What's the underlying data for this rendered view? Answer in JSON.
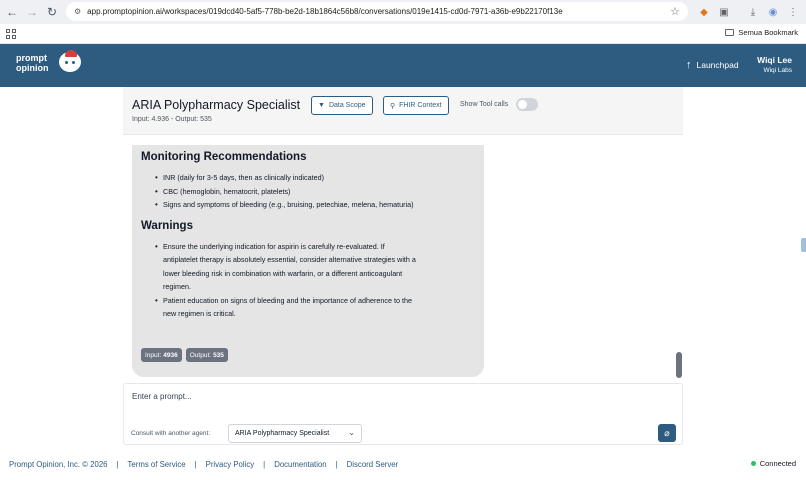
{
  "browser": {
    "url": "app.promptopinion.ai/workspaces/019dcd40-5af5-778b-be2d-18b1864c56b8/conversations/019e1415-cd0d-7971-a36b-e9b22170f13e",
    "bookmark_folder": "Semua Bookmark"
  },
  "header": {
    "logo_line1": "prompt",
    "logo_line2": "opinion",
    "launchpad_label": "Launchpad",
    "user_name": "Wiqi Lee",
    "user_org": "Wiqi Labs",
    "brand_color": "#2e5c80"
  },
  "conversation": {
    "title": "ARIA Polypharmacy Specialist",
    "tokens": "Input: 4.936 - Output: 535",
    "data_scope_label": "Data Scope",
    "fhir_context_label": "FHIR Context",
    "tool_calls_label": "Show Tool calls",
    "tool_calls_on": false
  },
  "message": {
    "section1_title": "Monitoring Recommendations",
    "section1_items": [
      "INR (daily for 3-5 days, then as clinically indicated)",
      "CBC (hemoglobin, hematocrit, platelets)",
      "Signs and symptoms of bleeding (e.g., bruising, petechiae, melena, hematuria)"
    ],
    "section2_title": "Warnings",
    "section2_item1_lines": [
      "Ensure the underlying indication for aspirin is carefully re-evaluated. If",
      "antiplatelet therapy is absolutely essential, consider alternative strategies with a",
      "lower bleeding risk in combination with warfarin, or a different anticoagulant",
      "regimen."
    ],
    "section2_item2_lines": [
      "Patient education on signs of bleeding and the importance of adherence to the",
      "new regimen is critical."
    ],
    "input_label": "Input:",
    "input_value": "4936",
    "output_label": "Output:",
    "output_value": "535"
  },
  "prompt": {
    "placeholder": "Enter a prompt...",
    "consult_label": "Consult with another agent:",
    "agent_selected": "ARIA Polypharmacy Specialist"
  },
  "footer": {
    "copyright": "Prompt Opinion, Inc. © 2026",
    "sep": "|",
    "links": [
      "Terms of Service",
      "Privacy Policy",
      "Documentation",
      "Discord Server"
    ],
    "status": "Connected",
    "status_color": "#22c55e"
  }
}
